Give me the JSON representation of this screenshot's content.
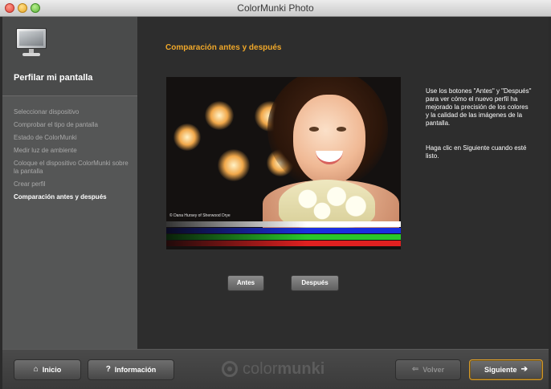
{
  "window": {
    "title": "ColorMunki Photo"
  },
  "sidebar": {
    "title": "Perfilar mi pantalla",
    "steps": [
      {
        "label": "Seleccionar dispositivo"
      },
      {
        "label": "Comprobar el tipo de pantalla"
      },
      {
        "label": "Estado de ColorMunki"
      },
      {
        "label": "Medir luz de ambiente"
      },
      {
        "label": "Coloque el dispositivo ColorMunki sobre la pantalla"
      },
      {
        "label": "Crear perfil"
      },
      {
        "label": "Comparación antes y después"
      }
    ],
    "active_index": 6
  },
  "main": {
    "title": "Comparación antes y después",
    "preview_credit": "© Dana Hursey of Sherwood Drye",
    "instructions": [
      "Use los botones \"Antes\" y \"Después\" para ver cómo el nuevo perfil ha mejorado la precisión de los colores y la calidad de las imágenes de la pantalla.",
      "Haga clic en Siguiente cuando esté listo."
    ],
    "buttons": {
      "before": "Antes",
      "after": "Después"
    }
  },
  "footer": {
    "home_label": "Inicio",
    "info_label": "Información",
    "back_label": "Volver",
    "next_label": "Siguiente",
    "logo_text_left": "color",
    "logo_text_right": "munki"
  },
  "colors": {
    "accent": "#f0a82a",
    "sidebar_bg": "#555656",
    "content_bg": "#2d2d2d",
    "next_border": "#d49a2c"
  }
}
